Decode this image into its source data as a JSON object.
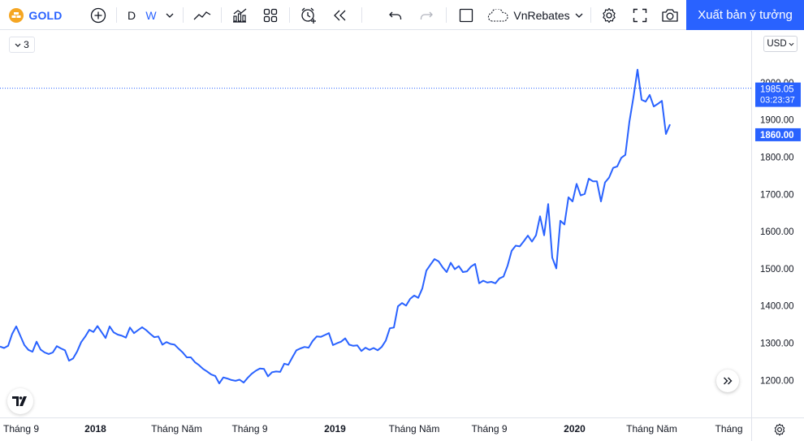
{
  "toolbar": {
    "symbol": "GOLD",
    "interval_d": "D",
    "interval_w": "W",
    "broker": "VnRebates",
    "publish_label": "Xuất bản ý tưởng"
  },
  "legend": {
    "count": "3"
  },
  "price_scale": {
    "currency": "USD",
    "crosshair_price": "1985.05",
    "countdown": "03:23:37",
    "last_price": "1860.00"
  },
  "colors": {
    "line": "#2962ff",
    "accent": "#2962ff",
    "symbol_badge": "#f5a623",
    "label_bg": "#2962ff"
  },
  "chart_data": {
    "type": "line",
    "series": [
      {
        "values": [
          [
            0,
            1291
          ],
          [
            2,
            1287
          ],
          [
            4,
            1293
          ],
          [
            6,
            1325
          ],
          [
            8,
            1345
          ],
          [
            10,
            1320
          ],
          [
            12,
            1295
          ],
          [
            14,
            1282
          ],
          [
            16,
            1277
          ],
          [
            18,
            1304
          ],
          [
            20,
            1283
          ],
          [
            22,
            1275
          ],
          [
            24,
            1271
          ],
          [
            26,
            1275
          ],
          [
            28,
            1292
          ],
          [
            30,
            1286
          ],
          [
            32,
            1281
          ],
          [
            34,
            1253
          ],
          [
            36,
            1259
          ],
          [
            38,
            1278
          ],
          [
            40,
            1303
          ],
          [
            42,
            1318
          ],
          [
            44,
            1336
          ],
          [
            46,
            1330
          ],
          [
            48,
            1346
          ],
          [
            50,
            1330
          ],
          [
            52,
            1314
          ],
          [
            54,
            1345
          ],
          [
            56,
            1329
          ],
          [
            58,
            1323
          ],
          [
            60,
            1320
          ],
          [
            62,
            1315
          ],
          [
            64,
            1342
          ],
          [
            66,
            1327
          ],
          [
            68,
            1335
          ],
          [
            70,
            1343
          ],
          [
            72,
            1335
          ],
          [
            74,
            1325
          ],
          [
            76,
            1316
          ],
          [
            78,
            1318
          ],
          [
            80,
            1296
          ],
          [
            82,
            1303
          ],
          [
            84,
            1298
          ],
          [
            86,
            1296
          ],
          [
            88,
            1285
          ],
          [
            90,
            1275
          ],
          [
            92,
            1262
          ],
          [
            94,
            1262
          ],
          [
            96,
            1249
          ],
          [
            98,
            1241
          ],
          [
            100,
            1231
          ],
          [
            102,
            1224
          ],
          [
            104,
            1216
          ],
          [
            106,
            1212
          ],
          [
            108,
            1192
          ],
          [
            110,
            1208
          ],
          [
            112,
            1205
          ],
          [
            114,
            1201
          ],
          [
            116,
            1199
          ],
          [
            118,
            1202
          ],
          [
            120,
            1194
          ],
          [
            122,
            1207
          ],
          [
            124,
            1218
          ],
          [
            126,
            1226
          ],
          [
            128,
            1232
          ],
          [
            130,
            1231
          ],
          [
            132,
            1211
          ],
          [
            134,
            1222
          ],
          [
            136,
            1224
          ],
          [
            138,
            1223
          ],
          [
            140,
            1245
          ],
          [
            142,
            1242
          ],
          [
            144,
            1262
          ],
          [
            146,
            1281
          ],
          [
            148,
            1286
          ],
          [
            150,
            1290
          ],
          [
            152,
            1288
          ],
          [
            154,
            1306
          ],
          [
            156,
            1318
          ],
          [
            158,
            1317
          ],
          [
            160,
            1322
          ],
          [
            162,
            1327
          ],
          [
            164,
            1295
          ],
          [
            166,
            1300
          ],
          [
            168,
            1304
          ],
          [
            170,
            1313
          ],
          [
            172,
            1296
          ],
          [
            174,
            1293
          ],
          [
            176,
            1294
          ],
          [
            178,
            1279
          ],
          [
            180,
            1288
          ],
          [
            182,
            1282
          ],
          [
            184,
            1287
          ],
          [
            186,
            1281
          ],
          [
            188,
            1290
          ],
          [
            190,
            1307
          ],
          [
            192,
            1340
          ],
          [
            194,
            1342
          ],
          [
            196,
            1399
          ],
          [
            198,
            1408
          ],
          [
            200,
            1401
          ],
          [
            202,
            1419
          ],
          [
            204,
            1428
          ],
          [
            206,
            1422
          ],
          [
            208,
            1447
          ],
          [
            210,
            1495
          ],
          [
            212,
            1511
          ],
          [
            214,
            1526
          ],
          [
            216,
            1520
          ],
          [
            218,
            1504
          ],
          [
            220,
            1491
          ],
          [
            222,
            1516
          ],
          [
            224,
            1499
          ],
          [
            226,
            1507
          ],
          [
            228,
            1491
          ],
          [
            230,
            1493
          ],
          [
            232,
            1506
          ],
          [
            234,
            1513
          ],
          [
            236,
            1461
          ],
          [
            238,
            1468
          ],
          [
            240,
            1463
          ],
          [
            242,
            1465
          ],
          [
            244,
            1461
          ],
          [
            246,
            1474
          ],
          [
            248,
            1479
          ],
          [
            250,
            1508
          ],
          [
            252,
            1548
          ],
          [
            254,
            1562
          ],
          [
            256,
            1560
          ],
          [
            258,
            1574
          ],
          [
            260,
            1589
          ],
          [
            262,
            1573
          ],
          [
            264,
            1590
          ],
          [
            266,
            1641
          ],
          [
            268,
            1590
          ],
          [
            270,
            1674
          ],
          [
            272,
            1530
          ],
          [
            274,
            1501
          ],
          [
            276,
            1629
          ],
          [
            278,
            1619
          ],
          [
            280,
            1692
          ],
          [
            282,
            1681
          ],
          [
            284,
            1728
          ],
          [
            286,
            1697
          ],
          [
            288,
            1701
          ],
          [
            290,
            1742
          ],
          [
            292,
            1735
          ],
          [
            294,
            1735
          ],
          [
            296,
            1681
          ],
          [
            298,
            1732
          ],
          [
            300,
            1745
          ],
          [
            302,
            1771
          ],
          [
            304,
            1775
          ],
          [
            306,
            1798
          ],
          [
            308,
            1806
          ],
          [
            310,
            1895
          ],
          [
            312,
            1961
          ],
          [
            314,
            2035
          ],
          [
            316,
            1954
          ],
          [
            318,
            1949
          ],
          [
            320,
            1967
          ],
          [
            322,
            1936
          ],
          [
            324,
            1943
          ],
          [
            326,
            1951
          ],
          [
            328,
            1862
          ],
          [
            330,
            1888
          ]
        ]
      }
    ],
    "x_ticks": [
      {
        "x": 0,
        "label": "Tháng 9"
      },
      {
        "x": 47,
        "label": "2018"
      },
      {
        "x": 87,
        "label": "Tháng Năm"
      },
      {
        "x": 123,
        "label": "Tháng 9"
      },
      {
        "x": 165,
        "label": "2019"
      },
      {
        "x": 204,
        "label": "Tháng Năm"
      },
      {
        "x": 241,
        "label": "Tháng 9"
      },
      {
        "x": 283,
        "label": "2020"
      },
      {
        "x": 321,
        "label": "Tháng Năm"
      },
      {
        "x": 359,
        "label": "Tháng"
      }
    ],
    "y_ticks": [
      1200,
      1300,
      1400,
      1500,
      1600,
      1700,
      1800,
      1900,
      2000
    ],
    "x_range": [
      0,
      370
    ],
    "y_range": [
      1150,
      2085
    ],
    "crosshair_price": 1985.05,
    "last_price": 1860,
    "grid": false
  }
}
